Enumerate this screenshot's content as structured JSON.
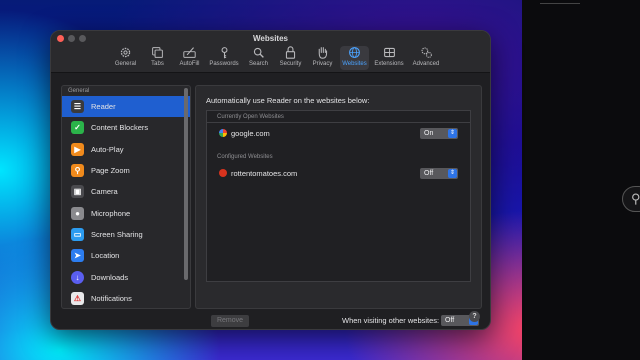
{
  "window": {
    "title": "Websites"
  },
  "toolbar": [
    {
      "label": "General",
      "icon": "gear-icon"
    },
    {
      "label": "Tabs",
      "icon": "tabs-icon"
    },
    {
      "label": "AutoFill",
      "icon": "autofill-icon"
    },
    {
      "label": "Passwords",
      "icon": "key-icon"
    },
    {
      "label": "Search",
      "icon": "search-icon"
    },
    {
      "label": "Security",
      "icon": "lock-icon"
    },
    {
      "label": "Privacy",
      "icon": "hand-icon"
    },
    {
      "label": "Websites",
      "icon": "globe-icon",
      "active": true
    },
    {
      "label": "Extensions",
      "icon": "extensions-icon"
    },
    {
      "label": "Advanced",
      "icon": "gears-icon"
    }
  ],
  "sidebar": {
    "section": "General",
    "items": [
      {
        "label": "Reader",
        "icon": "reader-icon",
        "color": "#3a3a3c",
        "selected": true
      },
      {
        "label": "Content Blockers",
        "icon": "content-blockers-icon",
        "color": "#2bb34a"
      },
      {
        "label": "Auto-Play",
        "icon": "play-icon",
        "color": "#f08a1c"
      },
      {
        "label": "Page Zoom",
        "icon": "magnifier-icon",
        "color": "#f08a1c"
      },
      {
        "label": "Camera",
        "icon": "camera-icon",
        "color": "#4a4a4e"
      },
      {
        "label": "Microphone",
        "icon": "microphone-icon",
        "color": "#8a8a8e"
      },
      {
        "label": "Screen Sharing",
        "icon": "screen-sharing-icon",
        "color": "#2c9cf0"
      },
      {
        "label": "Location",
        "icon": "location-arrow-icon",
        "color": "#2c7df0"
      },
      {
        "label": "Downloads",
        "icon": "download-icon",
        "color": "#5a5ef0"
      },
      {
        "label": "Notifications",
        "icon": "notifications-icon",
        "color": "#e8e8ea"
      }
    ]
  },
  "main": {
    "heading": "Automatically use Reader on the websites below:",
    "sections": [
      {
        "title": "Currently Open Websites",
        "rows": [
          {
            "site": "google.com",
            "value": "On"
          }
        ]
      },
      {
        "title": "Configured Websites",
        "rows": [
          {
            "site": "rottentomatoes.com",
            "value": "Off"
          }
        ]
      }
    ],
    "remove_label": "Remove",
    "other_label": "When visiting other websites:",
    "other_value": "Off"
  },
  "help": "?"
}
